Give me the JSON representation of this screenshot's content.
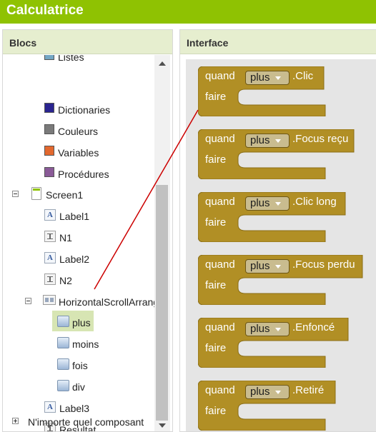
{
  "app": {
    "title": "Calculatrice"
  },
  "colors": {
    "title_bar": "#8fc202",
    "panel_header": "#e6eecf",
    "event_block": "#b18f25",
    "selection": "#d7e5b3",
    "connector_line": "#cc0000"
  },
  "blocks_panel": {
    "header": "Blocs",
    "items": [
      {
        "label": "Listes",
        "icon": "list-icon"
      },
      {
        "label": "Dictionaries",
        "color": "#2a2490"
      },
      {
        "label": "Couleurs",
        "color": "#7a7a7a"
      },
      {
        "label": "Variables",
        "color": "#e2682e"
      },
      {
        "label": "Procédures",
        "color": "#8a5a97"
      }
    ],
    "tree": {
      "screen": "Screen1",
      "label1": "Label1",
      "n1": "N1",
      "label2": "Label2",
      "n2": "N2",
      "hsa": "HorizontalScrollArrang",
      "plus": "plus",
      "moins": "moins",
      "fois": "fois",
      "div": "div",
      "label3": "Label3",
      "resultat": "Resultat",
      "any": "N'importe quel composant"
    }
  },
  "viewer": {
    "header": "Interface",
    "blocks": [
      {
        "when": "quand",
        "component": "plus",
        "event": ".Clic",
        "do": "faire"
      },
      {
        "when": "quand",
        "component": "plus",
        "event": ".Focus reçu",
        "do": "faire"
      },
      {
        "when": "quand",
        "component": "plus",
        "event": ".Clic long",
        "do": "faire"
      },
      {
        "when": "quand",
        "component": "plus",
        "event": ".Focus perdu",
        "do": "faire"
      },
      {
        "when": "quand",
        "component": "plus",
        "event": ".Enfoncé",
        "do": "faire"
      },
      {
        "when": "quand",
        "component": "plus",
        "event": ".Retiré",
        "do": "faire"
      }
    ]
  }
}
